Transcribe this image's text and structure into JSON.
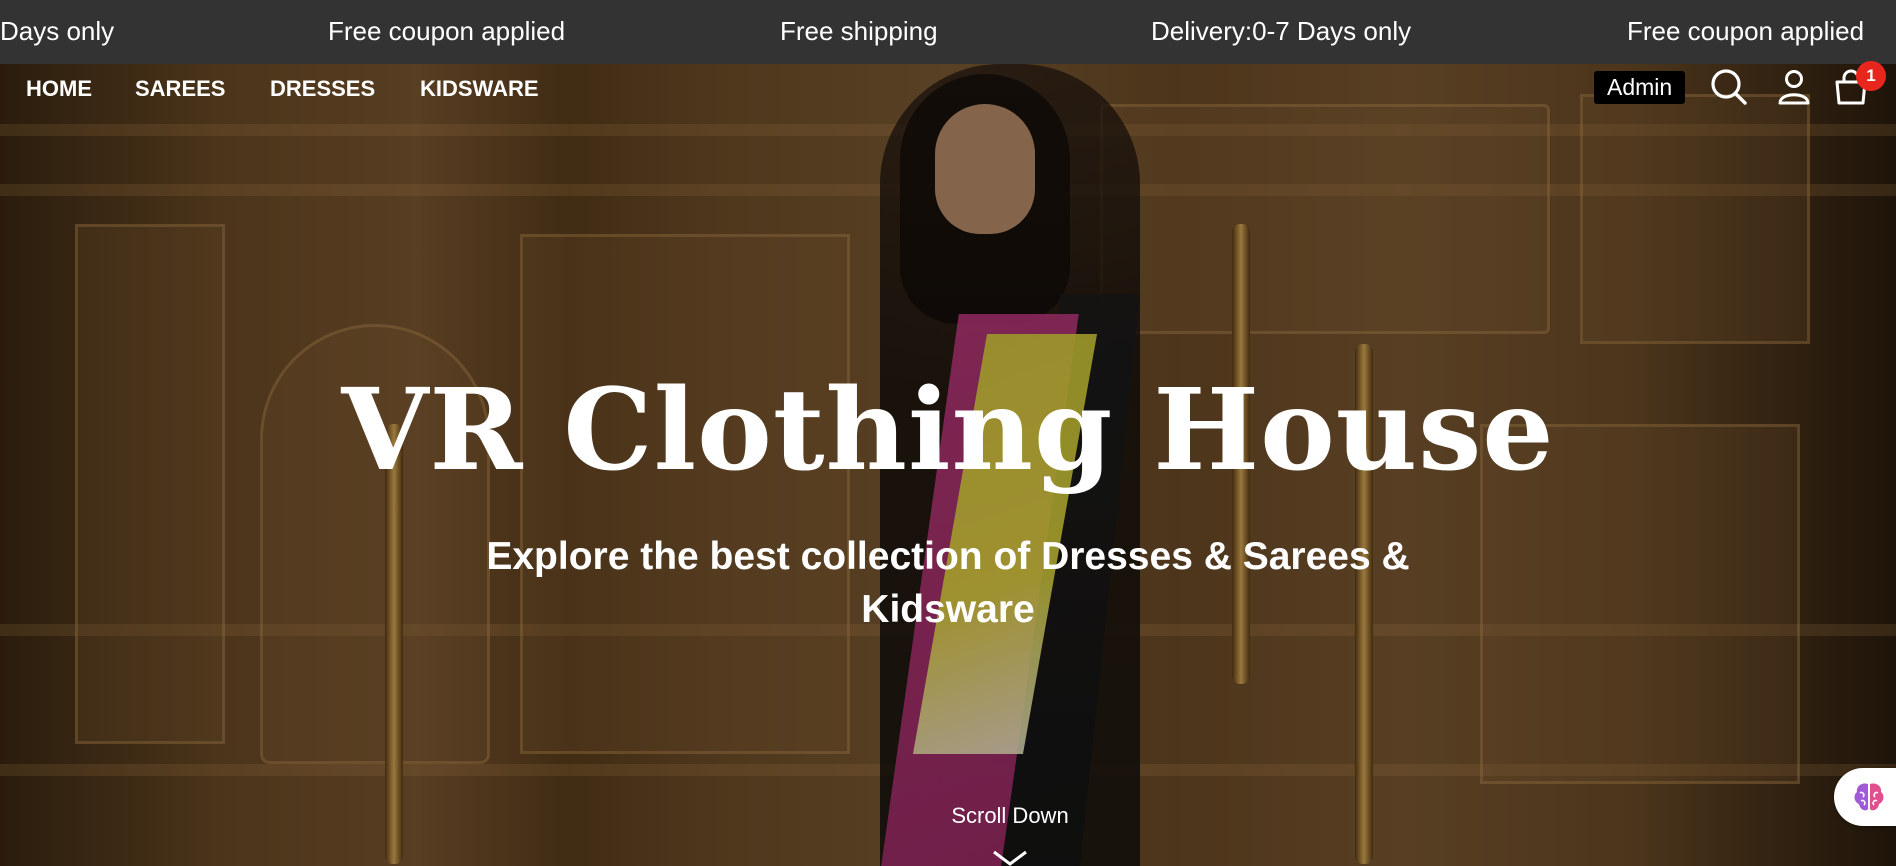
{
  "announcement": {
    "messages": [
      "Days only",
      "Free coupon applied",
      "Free shipping",
      "Delivery:0-7 Days only",
      "Free coupon applied"
    ]
  },
  "nav": {
    "items": [
      "HOME",
      "SAREES",
      "DRESSES",
      "KIDSWARE"
    ]
  },
  "header": {
    "admin_label": "Admin",
    "cart_count": "1",
    "icons": [
      "search-icon",
      "user-icon",
      "cart-icon"
    ]
  },
  "hero": {
    "title": "VR Clothing House",
    "subtitle": "Explore the best collection of Dresses & Sarees & Kidsware",
    "scroll_label": "Scroll Down"
  },
  "colors": {
    "announcement_bg": "#333333",
    "badge": "#e8261d",
    "admin_bg": "#000000",
    "text": "#ffffff"
  }
}
